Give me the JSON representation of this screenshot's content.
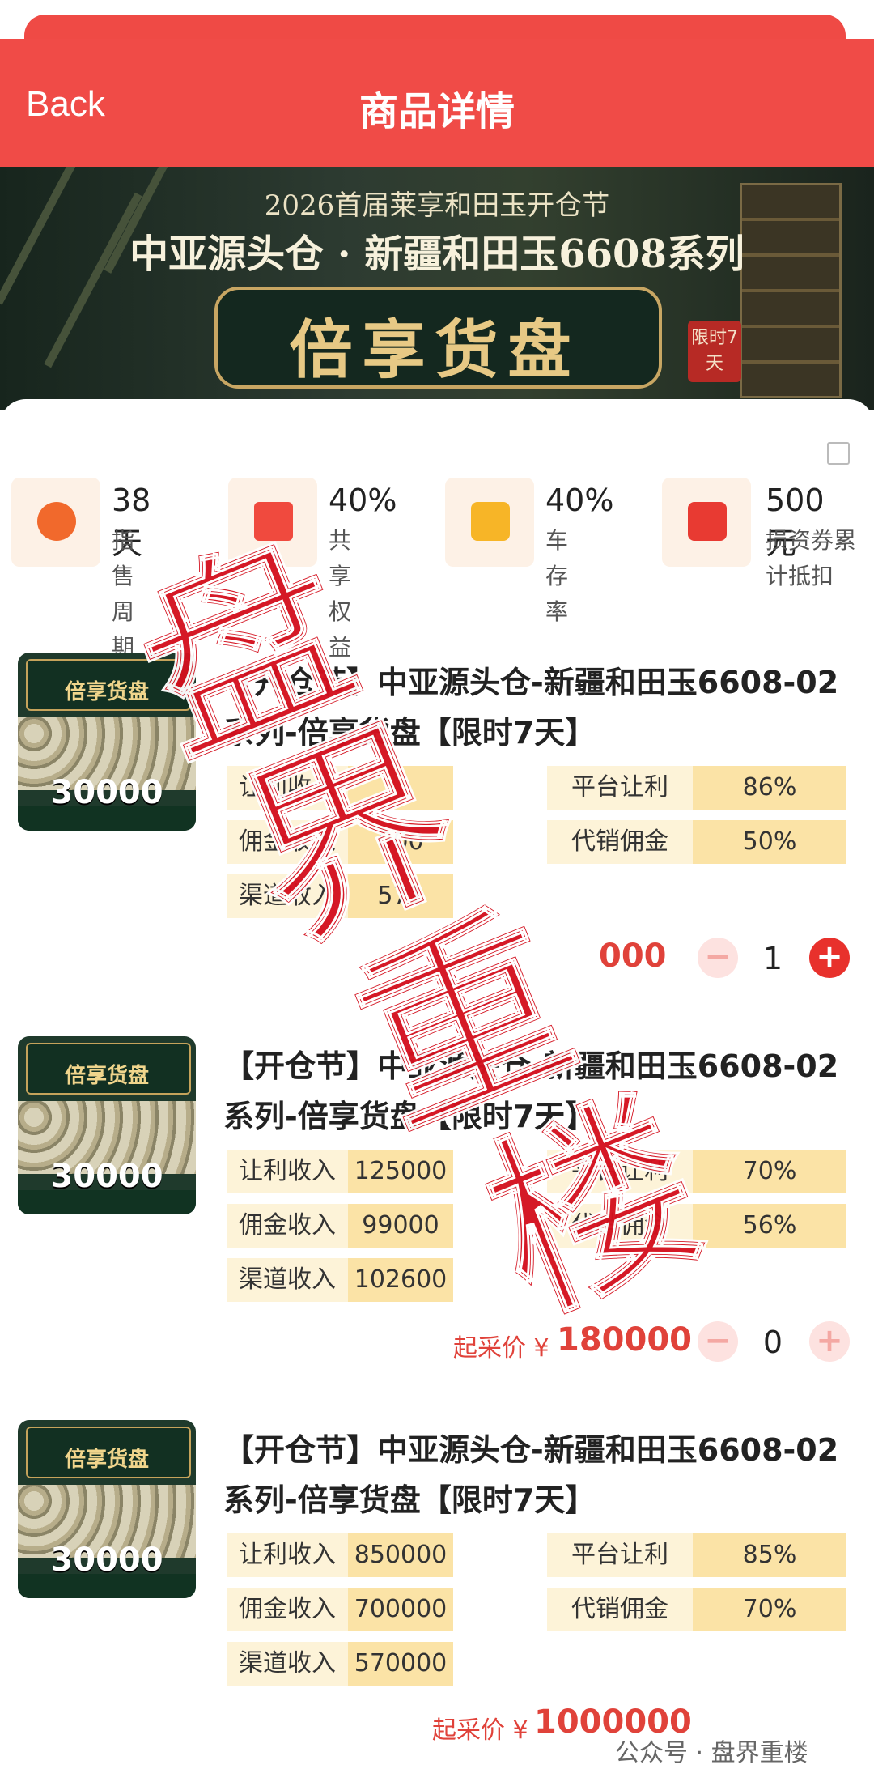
{
  "header": {
    "back_label": "Back",
    "title": "商品详情"
  },
  "banner": {
    "subtitle": "2026首届莱享和田玉开仓节",
    "title": "中亚源头仓 · 新疆和田玉6608系列",
    "main_text": "倍享货盘",
    "seal_text": "限时7天"
  },
  "stats": [
    {
      "value": "38天",
      "label": "指售周期"
    },
    {
      "value": "40%",
      "label": "共享权益"
    },
    {
      "value": "40%",
      "label": "车存率"
    },
    {
      "value": "500元",
      "label": "损资券累计抵扣"
    }
  ],
  "thumb": {
    "board_text": "倍享货盘",
    "price_text": "30000"
  },
  "products": [
    {
      "title": "【开仓节】中亚源头仓-新疆和田玉6608-02系列-倍享货盘【限时7天】",
      "rows": [
        {
          "label": "让利收入",
          "value": ""
        },
        {
          "label": "佣金收入",
          "value": "000"
        },
        {
          "label": "渠道收入",
          "value": "571"
        }
      ],
      "right_rows": [
        {
          "label": "平台让利",
          "value": "86%"
        },
        {
          "label": "代销佣金",
          "value": "50%"
        }
      ],
      "price_label": "起采价 ¥",
      "price": "000",
      "qty": "1"
    },
    {
      "title": "【开仓节】中亚源头仓-新疆和田玉6608-02系列-倍享货盘【限时7天】",
      "rows": [
        {
          "label": "让利收入",
          "value": "125000"
        },
        {
          "label": "佣金收入",
          "value": "99000"
        },
        {
          "label": "渠道收入",
          "value": "102600"
        }
      ],
      "right_rows": [
        {
          "label": "平台让利",
          "value": "70%"
        },
        {
          "label": "代销佣金",
          "value": "56%"
        }
      ],
      "price_label": "起采价 ¥",
      "price": "180000",
      "qty": "0"
    },
    {
      "title": "【开仓节】中亚源头仓-新疆和田玉6608-02系列-倍享货盘【限时7天】",
      "rows": [
        {
          "label": "让利收入",
          "value": "850000"
        },
        {
          "label": "佣金收入",
          "value": "700000"
        },
        {
          "label": "渠道收入",
          "value": "570000"
        }
      ],
      "right_rows": [
        {
          "label": "平台让利",
          "value": "85%"
        },
        {
          "label": "代销佣金",
          "value": "70%"
        }
      ],
      "price_label": "起采价 ¥",
      "price": "1000000",
      "qty": ""
    }
  ],
  "watermark": {
    "chars": [
      "盘",
      "界",
      "重",
      "楼"
    ],
    "footer": "公众号 · 盘界重楼"
  },
  "colors": {
    "header": "#f04b47",
    "accent": "#e0423a",
    "pill_label": "#fdf3d8",
    "pill_value": "#fbe3a6"
  }
}
